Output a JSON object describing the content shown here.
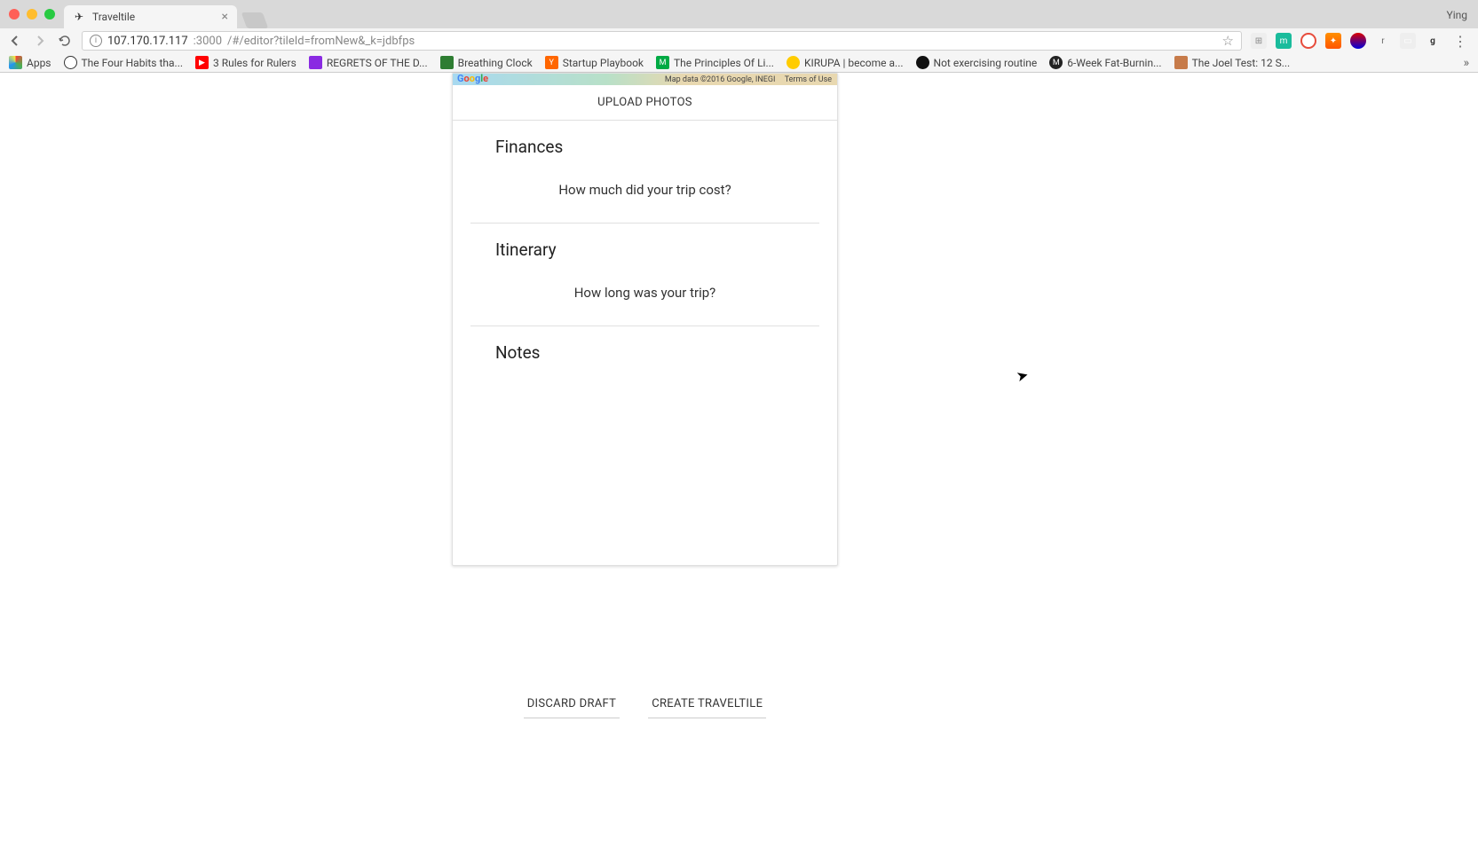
{
  "browser": {
    "profile": "Ying",
    "tab": {
      "title": "Traveltile"
    },
    "url_host": "107.170.17.117",
    "url_port": ":3000",
    "url_path": "/#/editor?tileId=fromNew&_k=jdbfps",
    "bookmarks": [
      {
        "label": "Apps",
        "color": "#fff"
      },
      {
        "label": "The Four Habits tha...",
        "color": "#333"
      },
      {
        "label": "3 Rules for Rulers",
        "color": "#ff0000"
      },
      {
        "label": "REGRETS OF THE D...",
        "color": "#8a2be2"
      },
      {
        "label": "Breathing Clock",
        "color": "#2e7d32"
      },
      {
        "label": "Startup Playbook",
        "color": "#ff6600"
      },
      {
        "label": "The Principles Of Li...",
        "color": "#00aa44"
      },
      {
        "label": "KIRUPA | become a...",
        "color": "#ffcc00"
      },
      {
        "label": "Not exercising routine",
        "color": "#111"
      },
      {
        "label": "6-Week Fat-Burnin...",
        "color": "#222"
      },
      {
        "label": "The Joel Test: 12 S...",
        "color": "#c77b4a"
      }
    ]
  },
  "map": {
    "credits": "Map data ©2016 Google, INEGI",
    "terms": "Terms of Use"
  },
  "card": {
    "upload_label": "UPLOAD PHOTOS",
    "finances": {
      "heading": "Finances",
      "prompt": "How much did your trip cost?"
    },
    "itinerary": {
      "heading": "Itinerary",
      "prompt": "How long was your trip?"
    },
    "notes": {
      "heading": "Notes"
    }
  },
  "actions": {
    "discard": "DISCARD DRAFT",
    "create": "CREATE TRAVELTILE"
  }
}
